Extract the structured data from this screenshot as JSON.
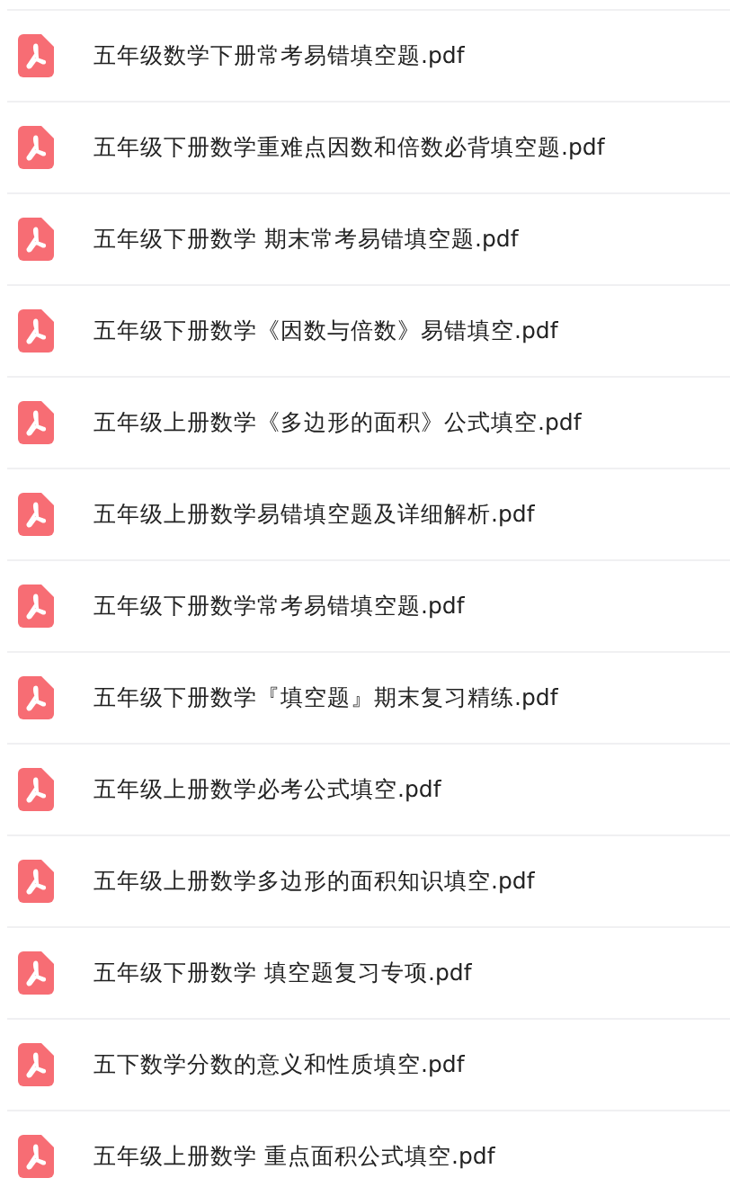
{
  "files": [
    {
      "name": "五年级数学下册常考易错填空题.pdf"
    },
    {
      "name": "五年级下册数学重难点因数和倍数必背填空题.pdf"
    },
    {
      "name": "五年级下册数学 期末常考易错填空题.pdf"
    },
    {
      "name": "五年级下册数学《因数与倍数》易错填空.pdf"
    },
    {
      "name": "五年级上册数学《多边形的面积》公式填空.pdf"
    },
    {
      "name": "五年级上册数学易错填空题及详细解析.pdf"
    },
    {
      "name": "五年级下册数学常考易错填空题.pdf"
    },
    {
      "name": "五年级下册数学『填空题』期末复习精练.pdf"
    },
    {
      "name": "五年级上册数学必考公式填空.pdf"
    },
    {
      "name": "五年级上册数学多边形的面积知识填空.pdf"
    },
    {
      "name": "五年级下册数学 填空题复习专项.pdf"
    },
    {
      "name": "五下数学分数的意义和性质填空.pdf"
    },
    {
      "name": "五年级上册数学 重点面积公式填空.pdf"
    }
  ]
}
